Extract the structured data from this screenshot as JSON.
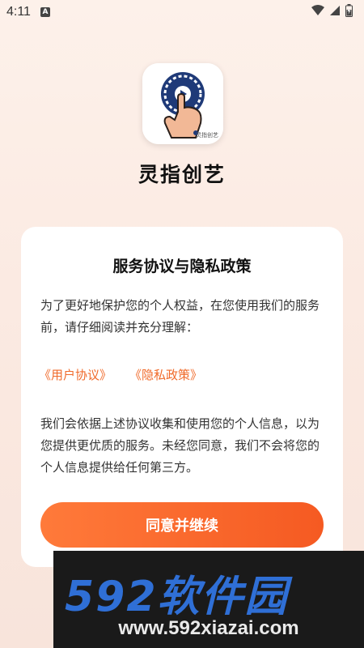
{
  "status_bar": {
    "time": "4:11",
    "notification_letter": "A",
    "icons": [
      "wifi-icon",
      "signal-icon",
      "battery-icon"
    ]
  },
  "app": {
    "name": "灵指创艺",
    "icon_badge": "灵指创艺"
  },
  "dialog": {
    "title": "服务协议与隐私政策",
    "intro": "为了更好地保护您的个人权益，在您使用我们的服务前，请仔细阅读并充分理解：",
    "links": {
      "user_agreement": "《用户协议》",
      "privacy_policy": "《隐私政策》"
    },
    "body": "我们会依据上述协议收集和使用您的个人信息，以为您提供更优质的服务。未经您同意，我们不会将您的个人信息提供给任何第三方。",
    "agree_button": "同意并继续"
  },
  "watermark": {
    "brand": "592软件园",
    "url": "www.592xiazai.com"
  },
  "colors": {
    "accent": "#f06a2a",
    "button_start": "#ff7a3a",
    "button_end": "#f55a22",
    "icon_circle": "#1f3a78"
  }
}
